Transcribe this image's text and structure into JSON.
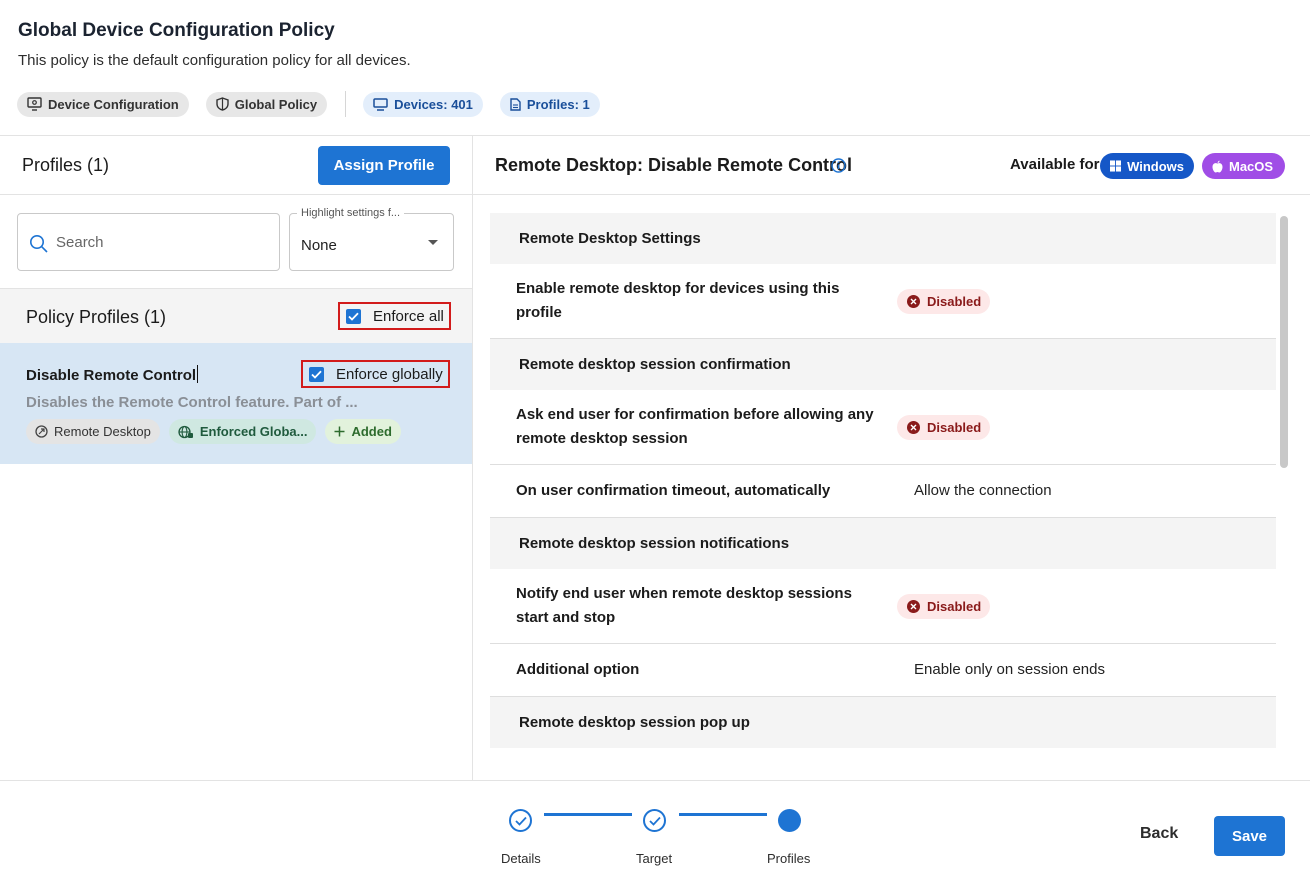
{
  "header": {
    "title": "Global Device Configuration Policy",
    "subtitle": "This policy is the default configuration policy for all devices.",
    "chips": {
      "device_configuration": "Device Configuration",
      "global_policy": "Global Policy",
      "devices": "Devices: 401",
      "profiles": "Profiles: 1"
    }
  },
  "left": {
    "profiles_title": "Profiles (1)",
    "assign_button": "Assign Profile",
    "search_placeholder": "Search",
    "highlight_label": "Highlight settings f...",
    "highlight_value": "None",
    "policy_profiles_title": "Policy Profiles (1)",
    "enforce_all_label": "Enforce all",
    "enforce_all_checked": true,
    "profile_card": {
      "name": "Disable Remote Control",
      "enforce_globally_label": "Enforce globally",
      "enforce_globally_checked": true,
      "description": "Disables the Remote Control feature. Part of ...",
      "tags": {
        "category": "Remote Desktop",
        "enforced": "Enforced Globa...",
        "added": "Added"
      }
    }
  },
  "right": {
    "title": "Remote Desktop: Disable Remote Control",
    "available_for_label": "Available for",
    "os": {
      "windows": "Windows",
      "macos": "MacOS"
    },
    "settings": {
      "s1_title": "Remote Desktop Settings",
      "s1_r1_label": "Enable remote desktop for devices using this profile",
      "s1_r1_status": "Disabled",
      "s2_title": "Remote desktop session confirmation",
      "s2_r1_label": "Ask end user for confirmation before allowing any remote desktop session",
      "s2_r1_status": "Disabled",
      "s2_r2_label": "On user confirmation timeout, automatically",
      "s2_r2_value": "Allow the connection",
      "s3_title": "Remote desktop session notifications",
      "s3_r1_label": "Notify end user when remote desktop sessions start and stop",
      "s3_r1_status": "Disabled",
      "s3_r2_label": "Additional option",
      "s3_r2_value": "Enable only on session ends",
      "s4_title": "Remote desktop session pop up"
    }
  },
  "footer": {
    "steps": {
      "details": "Details",
      "target": "Target",
      "profiles": "Profiles"
    },
    "back_button": "Back",
    "save_button": "Save"
  },
  "colors": {
    "primary": "#1e74d3",
    "windows": "#1557c7",
    "macos": "#a04de6",
    "selected_card": "#d7e6f4",
    "disabled_badge_bg": "#fde8e8",
    "disabled_badge_fg": "#8a1a1a",
    "highlight_border": "#d21b1b"
  }
}
